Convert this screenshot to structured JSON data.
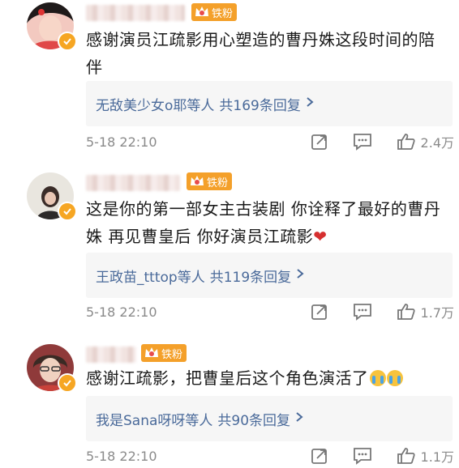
{
  "comments": [
    {
      "fan_badge": "铁粉",
      "text": "感谢演员江疏影用心塑造的曹丹姝这段时间的陪伴",
      "reply_summary": "无敌美少女o耶等人",
      "reply_count": "共169条回复",
      "time": "5-18 22:10",
      "likes": "2.4万"
    },
    {
      "fan_badge": "铁粉",
      "text": "这是你的第一部女主古装剧 你诠释了最好的曹丹姝 再见曹皇后 你好演员江疏影",
      "reply_summary": "王政苗_tttop等人",
      "reply_count": "共119条回复",
      "time": "5-18 22:10",
      "likes": "1.7万"
    },
    {
      "fan_badge": "铁粉",
      "text": "感谢江疏影，把曹皇后这个角色演活了",
      "reply_summary": "我是Sana呀呀等人",
      "reply_count": "共90条回复",
      "time": "5-18 22:10",
      "likes": "1.1万"
    }
  ],
  "icons": {
    "repost": "share-icon",
    "comment": "comment-icon",
    "like": "thumbs-up-icon",
    "verified": "verified-badge-icon",
    "reply_more": "chevron-right-icon"
  },
  "colors": {
    "badge": "#f4a02a",
    "link": "#4a6a9a",
    "meta": "#8a8a8a",
    "reply_bg": "#f6f6f6"
  }
}
